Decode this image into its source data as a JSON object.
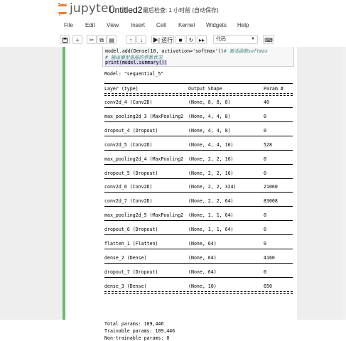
{
  "header": {
    "logo_text": "jupyter",
    "notebook_title": "Untitled2",
    "checkpoint": "最后检查: 1 小时前  (自动保存)"
  },
  "menu": [
    "File",
    "Edit",
    "View",
    "Insert",
    "Cell",
    "Kernel",
    "Widgets",
    "Help"
  ],
  "toolbar": {
    "run_label": "运行",
    "cell_type": "代码"
  },
  "code": {
    "line1": "model.add(Dense(10, activation='softmax'))",
    "line1_comment": "# 激活函数softmax",
    "line2": "# 输出模型各层的参数状况",
    "line3": "print(model.summary())"
  },
  "output": {
    "model_line": "Model: \"sequential_5\"",
    "headers": [
      "Layer (type)",
      "Output Shape",
      "Param #"
    ],
    "rows": [
      [
        "conv2d_4 (Conv2D)",
        "(None, 8, 8, 8)",
        "40"
      ],
      [
        "max_pooling2d_3 (MaxPooling2",
        "(None, 4, 4, 8)",
        "0"
      ],
      [
        "dropout_4 (Dropout)",
        "(None, 4, 4, 8)",
        "0"
      ],
      [
        "conv2d_5 (Conv2D)",
        "(None, 4, 4, 16)",
        "528"
      ],
      [
        "max_pooling2d_4 (MaxPooling2",
        "(None, 2, 2, 16)",
        "0"
      ],
      [
        "dropout_5 (Dropout)",
        "(None, 2, 2, 16)",
        "0"
      ],
      [
        "conv2d_6 (Conv2D)",
        "(None, 2, 2, 324)",
        "21060"
      ],
      [
        "conv2d_7 (Conv2D)",
        "(None, 2, 2, 64)",
        "83008"
      ],
      [
        "max_pooling2d_5 (MaxPooling2",
        "(None, 1, 1, 64)",
        "0"
      ],
      [
        "dropout_6 (Dropout)",
        "(None, 1, 1, 64)",
        "0"
      ],
      [
        "flatten_1 (Flatten)",
        "(None, 64)",
        "0"
      ],
      [
        "dense_2 (Dense)",
        "(None, 64)",
        "4160"
      ],
      [
        "dropout_7 (Dropout)",
        "(None, 64)",
        "0"
      ],
      [
        "dense_3 (Dense)",
        "(None, 10)",
        "650"
      ]
    ],
    "total_params": "Total params: 109,446",
    "trainable_params": "Trainable params: 109,446",
    "non_trainable_params": "Non-trainable params: 0"
  },
  "colors": {
    "cell_border": "#66bb6a",
    "comment": "#408080",
    "highlight": "#d7d4f0",
    "logo_orange": "#f37726"
  }
}
